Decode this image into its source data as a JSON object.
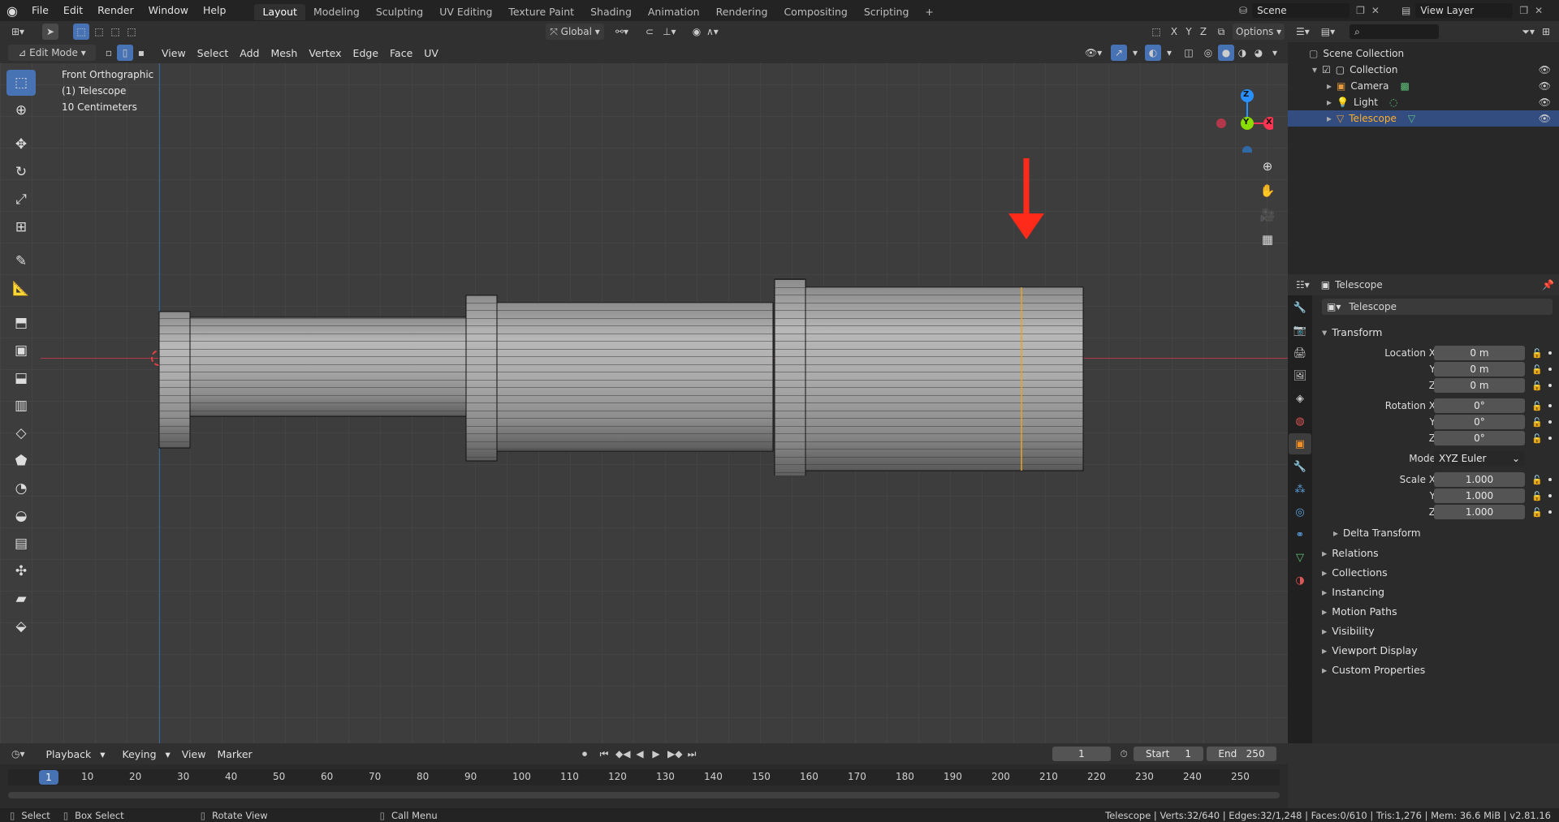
{
  "topbar": {
    "menu": [
      "File",
      "Edit",
      "Render",
      "Window",
      "Help"
    ],
    "workspaces": [
      "Layout",
      "Modeling",
      "Sculpting",
      "UV Editing",
      "Texture Paint",
      "Shading",
      "Animation",
      "Rendering",
      "Compositing",
      "Scripting"
    ],
    "active_workspace": "Layout",
    "plus": "+",
    "scene": "Scene",
    "view_layer": "View Layer"
  },
  "toolheader": {
    "orientation": "Global",
    "xyz": [
      "X",
      "Y",
      "Z"
    ],
    "options": "Options"
  },
  "viewport_header": {
    "mode": "Edit Mode",
    "menus": [
      "View",
      "Select",
      "Add",
      "Mesh",
      "Vertex",
      "Edge",
      "Face",
      "UV"
    ]
  },
  "overlay_text": {
    "view": "Front Orthographic",
    "object": "(1) Telescope",
    "scale": "10 Centimeters"
  },
  "gizmo": {
    "z": "Z",
    "y": "Y",
    "x": "X"
  },
  "outliner": {
    "root": "Scene Collection",
    "collection": "Collection",
    "items": [
      "Camera",
      "Light",
      "Telescope"
    ],
    "selected": "Telescope"
  },
  "properties": {
    "object_header": "Telescope",
    "object_name": "Telescope",
    "transform_title": "Transform",
    "location_label": "Location X",
    "location": [
      "0 m",
      "0 m",
      "0 m"
    ],
    "rotation_label": "Rotation X",
    "rotation": [
      "0°",
      "0°",
      "0°"
    ],
    "mode_label": "Mode",
    "mode": "XYZ Euler",
    "scale_label": "Scale X",
    "scale": [
      "1.000",
      "1.000",
      "1.000"
    ],
    "y_label": "Y",
    "z_label": "Z",
    "delta": "Delta Transform",
    "sections": [
      "Relations",
      "Collections",
      "Instancing",
      "Motion Paths",
      "Visibility",
      "Viewport Display",
      "Custom Properties"
    ]
  },
  "timeline": {
    "menus": [
      "Playback",
      "Keying",
      "View",
      "Marker"
    ],
    "current_frame": "1",
    "start_label": "Start",
    "start": "1",
    "end_label": "End",
    "end": "250",
    "ruler": [
      "10",
      "20",
      "30",
      "40",
      "50",
      "60",
      "70",
      "80",
      "90",
      "100",
      "110",
      "120",
      "130",
      "140",
      "150",
      "160",
      "170",
      "180",
      "190",
      "200",
      "210",
      "220",
      "230",
      "240",
      "250"
    ],
    "cursor": "1"
  },
  "statusbar": {
    "select": "Select",
    "box_select": "Box Select",
    "rotate_view": "Rotate View",
    "call_menu": "Call Menu",
    "stats": "Telescope | Verts:32/640 | Edges:32/1,248 | Faces:0/610 | Tris:1,276 | Mem: 36.6 MiB | v2.81.16"
  },
  "colors": {
    "accent": "#4772b3",
    "selected_row": "#334d80",
    "edge_loop": "#e8a321",
    "arrow": "#ff2a1a",
    "x_axis": "#ff3352",
    "y_axis": "#8bdc00",
    "z_axis": "#2890ff"
  }
}
